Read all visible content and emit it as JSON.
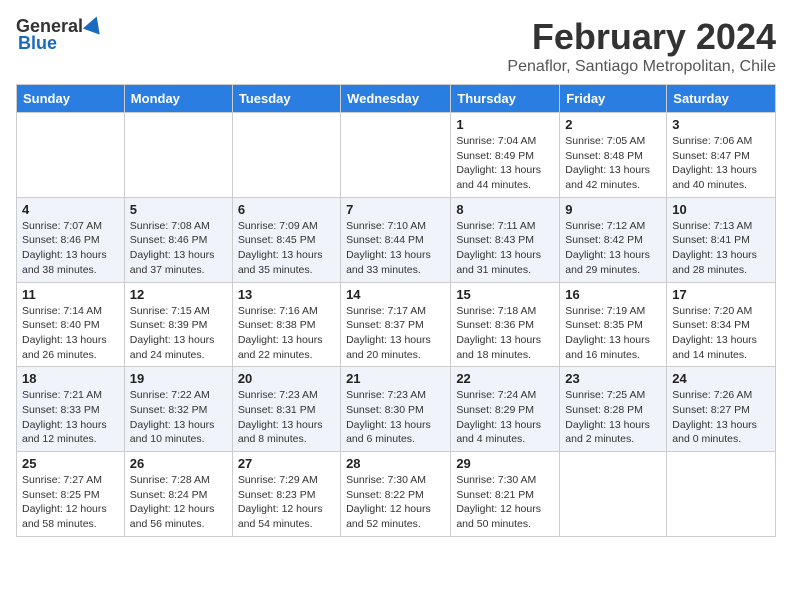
{
  "header": {
    "logo_general": "General",
    "logo_blue": "Blue",
    "title": "February 2024",
    "subtitle": "Penaflor, Santiago Metropolitan, Chile"
  },
  "calendar": {
    "days_of_week": [
      "Sunday",
      "Monday",
      "Tuesday",
      "Wednesday",
      "Thursday",
      "Friday",
      "Saturday"
    ],
    "weeks": [
      [
        {
          "day": "",
          "text": ""
        },
        {
          "day": "",
          "text": ""
        },
        {
          "day": "",
          "text": ""
        },
        {
          "day": "",
          "text": ""
        },
        {
          "day": "1",
          "text": "Sunrise: 7:04 AM\nSunset: 8:49 PM\nDaylight: 13 hours\nand 44 minutes."
        },
        {
          "day": "2",
          "text": "Sunrise: 7:05 AM\nSunset: 8:48 PM\nDaylight: 13 hours\nand 42 minutes."
        },
        {
          "day": "3",
          "text": "Sunrise: 7:06 AM\nSunset: 8:47 PM\nDaylight: 13 hours\nand 40 minutes."
        }
      ],
      [
        {
          "day": "4",
          "text": "Sunrise: 7:07 AM\nSunset: 8:46 PM\nDaylight: 13 hours\nand 38 minutes."
        },
        {
          "day": "5",
          "text": "Sunrise: 7:08 AM\nSunset: 8:46 PM\nDaylight: 13 hours\nand 37 minutes."
        },
        {
          "day": "6",
          "text": "Sunrise: 7:09 AM\nSunset: 8:45 PM\nDaylight: 13 hours\nand 35 minutes."
        },
        {
          "day": "7",
          "text": "Sunrise: 7:10 AM\nSunset: 8:44 PM\nDaylight: 13 hours\nand 33 minutes."
        },
        {
          "day": "8",
          "text": "Sunrise: 7:11 AM\nSunset: 8:43 PM\nDaylight: 13 hours\nand 31 minutes."
        },
        {
          "day": "9",
          "text": "Sunrise: 7:12 AM\nSunset: 8:42 PM\nDaylight: 13 hours\nand 29 minutes."
        },
        {
          "day": "10",
          "text": "Sunrise: 7:13 AM\nSunset: 8:41 PM\nDaylight: 13 hours\nand 28 minutes."
        }
      ],
      [
        {
          "day": "11",
          "text": "Sunrise: 7:14 AM\nSunset: 8:40 PM\nDaylight: 13 hours\nand 26 minutes."
        },
        {
          "day": "12",
          "text": "Sunrise: 7:15 AM\nSunset: 8:39 PM\nDaylight: 13 hours\nand 24 minutes."
        },
        {
          "day": "13",
          "text": "Sunrise: 7:16 AM\nSunset: 8:38 PM\nDaylight: 13 hours\nand 22 minutes."
        },
        {
          "day": "14",
          "text": "Sunrise: 7:17 AM\nSunset: 8:37 PM\nDaylight: 13 hours\nand 20 minutes."
        },
        {
          "day": "15",
          "text": "Sunrise: 7:18 AM\nSunset: 8:36 PM\nDaylight: 13 hours\nand 18 minutes."
        },
        {
          "day": "16",
          "text": "Sunrise: 7:19 AM\nSunset: 8:35 PM\nDaylight: 13 hours\nand 16 minutes."
        },
        {
          "day": "17",
          "text": "Sunrise: 7:20 AM\nSunset: 8:34 PM\nDaylight: 13 hours\nand 14 minutes."
        }
      ],
      [
        {
          "day": "18",
          "text": "Sunrise: 7:21 AM\nSunset: 8:33 PM\nDaylight: 13 hours\nand 12 minutes."
        },
        {
          "day": "19",
          "text": "Sunrise: 7:22 AM\nSunset: 8:32 PM\nDaylight: 13 hours\nand 10 minutes."
        },
        {
          "day": "20",
          "text": "Sunrise: 7:23 AM\nSunset: 8:31 PM\nDaylight: 13 hours\nand 8 minutes."
        },
        {
          "day": "21",
          "text": "Sunrise: 7:23 AM\nSunset: 8:30 PM\nDaylight: 13 hours\nand 6 minutes."
        },
        {
          "day": "22",
          "text": "Sunrise: 7:24 AM\nSunset: 8:29 PM\nDaylight: 13 hours\nand 4 minutes."
        },
        {
          "day": "23",
          "text": "Sunrise: 7:25 AM\nSunset: 8:28 PM\nDaylight: 13 hours\nand 2 minutes."
        },
        {
          "day": "24",
          "text": "Sunrise: 7:26 AM\nSunset: 8:27 PM\nDaylight: 13 hours\nand 0 minutes."
        }
      ],
      [
        {
          "day": "25",
          "text": "Sunrise: 7:27 AM\nSunset: 8:25 PM\nDaylight: 12 hours\nand 58 minutes."
        },
        {
          "day": "26",
          "text": "Sunrise: 7:28 AM\nSunset: 8:24 PM\nDaylight: 12 hours\nand 56 minutes."
        },
        {
          "day": "27",
          "text": "Sunrise: 7:29 AM\nSunset: 8:23 PM\nDaylight: 12 hours\nand 54 minutes."
        },
        {
          "day": "28",
          "text": "Sunrise: 7:30 AM\nSunset: 8:22 PM\nDaylight: 12 hours\nand 52 minutes."
        },
        {
          "day": "29",
          "text": "Sunrise: 7:30 AM\nSunset: 8:21 PM\nDaylight: 12 hours\nand 50 minutes."
        },
        {
          "day": "",
          "text": ""
        },
        {
          "day": "",
          "text": ""
        }
      ]
    ]
  }
}
